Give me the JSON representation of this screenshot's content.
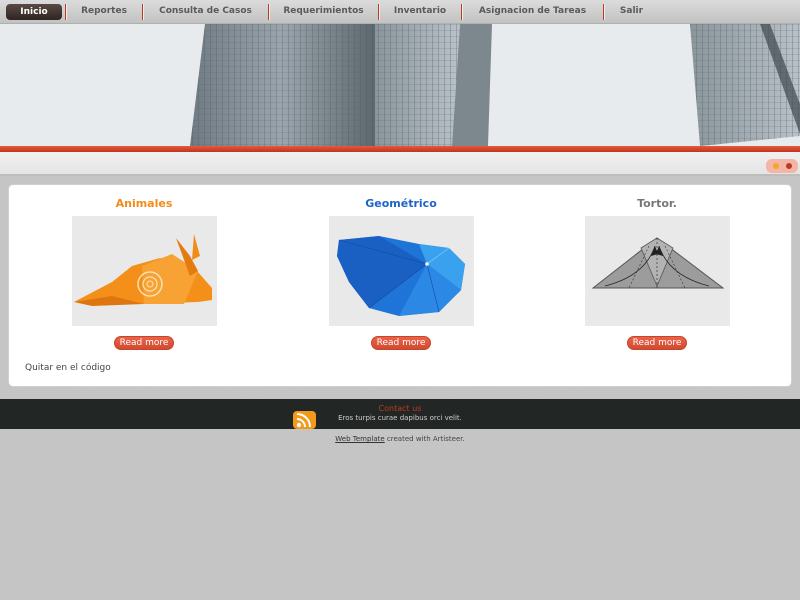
{
  "nav": {
    "items": [
      {
        "label": "Inicio",
        "active": true
      },
      {
        "label": "Reportes"
      },
      {
        "label": "Consulta de Casos"
      },
      {
        "label": "Requerimientos"
      },
      {
        "label": "Inventario"
      },
      {
        "label": "Asignacion de Tareas"
      },
      {
        "label": "Salir"
      }
    ]
  },
  "colors": {
    "accent": "#d24a2f",
    "orange": "#f28c18",
    "blue": "#1d63c9",
    "gray_title": "#777777"
  },
  "cards": [
    {
      "title": "Animales",
      "image": "origami-snail",
      "button": "Read more"
    },
    {
      "title": "Geométrico",
      "image": "origami-geometric-shell",
      "button": "Read more"
    },
    {
      "title": "Tortor.",
      "image": "origami-triangle-diagram",
      "button": "Read more"
    }
  ],
  "content": {
    "note": "Quitar en el código"
  },
  "footer": {
    "contact": "Contact us",
    "text": "Eros turpis curae dapibus orci velit.",
    "credit_link": "Web Template",
    "credit_text": " created with Artisteer."
  }
}
